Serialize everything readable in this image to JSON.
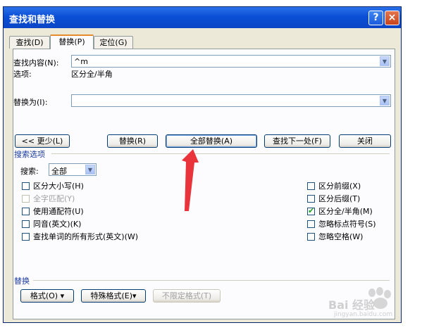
{
  "window": {
    "title": "查找和替换",
    "help_icon": "?",
    "close_icon": "×"
  },
  "tabs": [
    {
      "label": "查找(D)",
      "active": false
    },
    {
      "label": "替换(P)",
      "active": true
    },
    {
      "label": "定位(G)",
      "active": false
    }
  ],
  "find": {
    "label": "查找内容(N):",
    "value": "^m",
    "options_label": "选项:",
    "options_value": "区分全/半角"
  },
  "replace": {
    "label": "替换为(I):",
    "value": ""
  },
  "buttons": {
    "less": "<< 更少(L)",
    "replace": "替换(R)",
    "replace_all": "全部替换(A)",
    "find_next": "查找下一处(F)",
    "close": "关闭"
  },
  "search_options": {
    "heading": "搜索选项",
    "search_label": "搜索:",
    "search_value": "全部",
    "left": [
      {
        "label": "区分大小写(H)",
        "checked": false,
        "disabled": false
      },
      {
        "label": "全字匹配(Y)",
        "checked": false,
        "disabled": true
      },
      {
        "label": "使用通配符(U)",
        "checked": false,
        "disabled": false
      },
      {
        "label": "同音(英文)(K)",
        "checked": false,
        "disabled": false
      },
      {
        "label": "查找单词的所有形式(英文)(W)",
        "checked": false,
        "disabled": false
      }
    ],
    "right": [
      {
        "label": "区分前缀(X)",
        "checked": false,
        "disabled": false
      },
      {
        "label": "区分后缀(T)",
        "checked": false,
        "disabled": false
      },
      {
        "label": "区分全/半角(M)",
        "checked": true,
        "disabled": false
      },
      {
        "label": "忽略标点符号(S)",
        "checked": false,
        "disabled": false
      },
      {
        "label": "忽略空格(W)",
        "checked": false,
        "disabled": false
      }
    ]
  },
  "replace_section": {
    "heading": "替换",
    "format_btn": "格式(O) ▾",
    "special_btn": "特殊格式(E)▾",
    "no_format_btn": "不限定格式(T)"
  },
  "watermark": {
    "text": "Bai 经验",
    "sub": "jingyan.baidu.com"
  },
  "colors": {
    "titlebar": "#0b4fd6",
    "dialog_bg": "#ece9d8",
    "arrow": "#e8343a",
    "section_text": "#1b3b9c"
  }
}
